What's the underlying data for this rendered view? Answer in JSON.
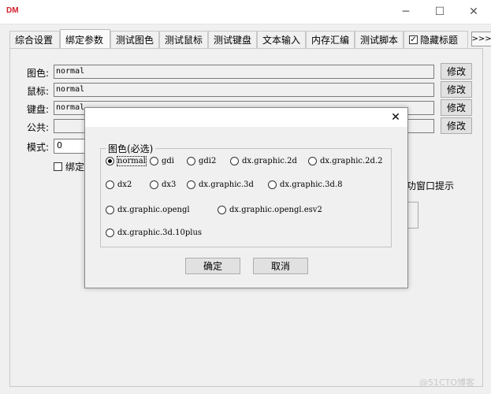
{
  "window": {
    "logo": "DM",
    "minimize_glyph": "─",
    "maximize_glyph": "☐",
    "close_glyph": "✕"
  },
  "tabs": [
    {
      "label": "综合设置"
    },
    {
      "label": "绑定参数"
    },
    {
      "label": "测试图色"
    },
    {
      "label": "测试鼠标"
    },
    {
      "label": "测试键盘"
    },
    {
      "label": "文本输入"
    },
    {
      "label": "内存汇编"
    },
    {
      "label": "测试脚本"
    },
    {
      "label": "隐藏标题",
      "checked": true
    }
  ],
  "tab_more_label": ">>>",
  "tab_check_mark": "✓",
  "form": {
    "rows": [
      {
        "label": "图色:",
        "value": "normal",
        "button": "修改"
      },
      {
        "label": "鼠标:",
        "value": "normal",
        "button": "修改"
      },
      {
        "label": "键盘:",
        "value": "normal",
        "button": "修改"
      },
      {
        "label": "公共:",
        "value": "",
        "button": "修改"
      }
    ],
    "mode_label": "模式:",
    "mode_value": "0",
    "bind_checkbox_label": "绑定",
    "hint_partial": "功窗口提示"
  },
  "watermark": "@51CTO博客",
  "dialog": {
    "close_glyph": "✕",
    "group_title": "图色(必选)",
    "options": [
      {
        "label": "normal",
        "checked": true
      },
      {
        "label": "gdi",
        "checked": false
      },
      {
        "label": "gdi2",
        "checked": false
      },
      {
        "label": "dx.graphic.2d",
        "checked": false
      },
      {
        "label": "dx.graphic.2d.2",
        "checked": false
      },
      {
        "label": "dx2",
        "checked": false
      },
      {
        "label": "dx3",
        "checked": false
      },
      {
        "label": "dx.graphic.3d",
        "checked": false
      },
      {
        "label": "dx.graphic.3d.8",
        "checked": false
      },
      {
        "label": "dx.graphic.opengl",
        "checked": false
      },
      {
        "label": "dx.graphic.opengl.esv2",
        "checked": false
      },
      {
        "label": "dx.graphic.3d.10plus",
        "checked": false
      }
    ],
    "ok_label": "确定",
    "cancel_label": "取消"
  }
}
